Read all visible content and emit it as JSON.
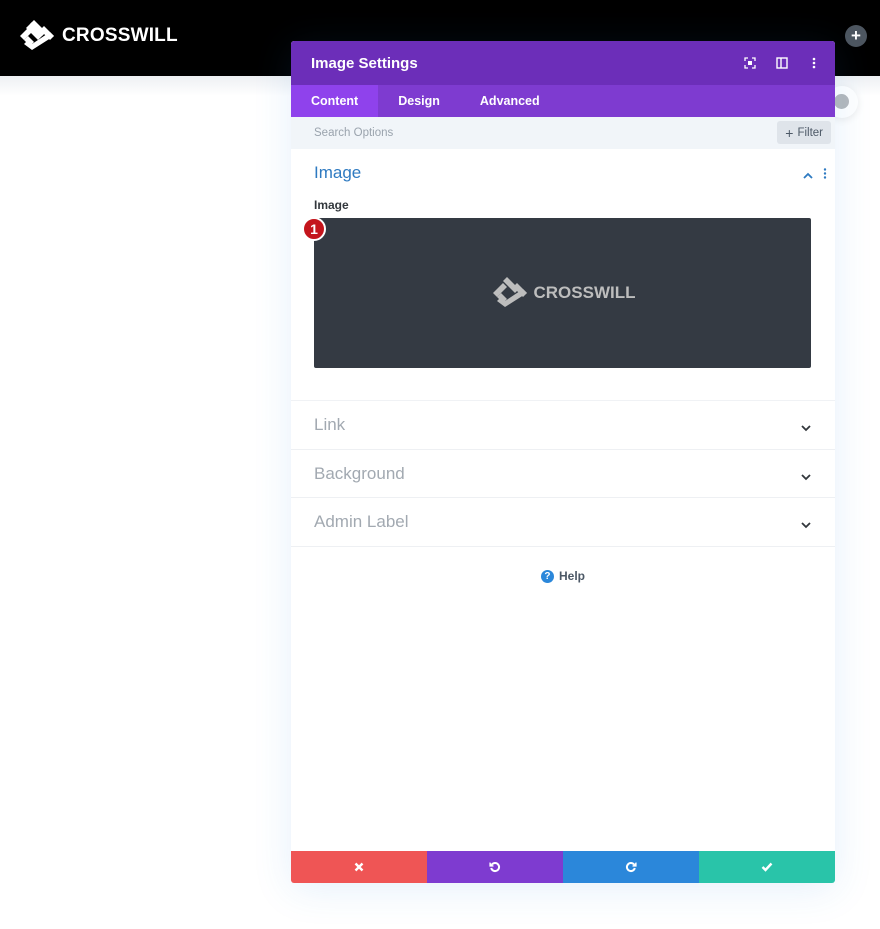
{
  "site": {
    "logo_text": "CROSSWILL"
  },
  "modal": {
    "title": "Image Settings",
    "header_icons": [
      "fullscreen-icon",
      "split-view-icon",
      "more-options-icon"
    ],
    "tabs": [
      {
        "label": "Content",
        "active": true
      },
      {
        "label": "Design",
        "active": false
      },
      {
        "label": "Advanced",
        "active": false
      }
    ],
    "search": {
      "placeholder": "Search Options",
      "value": ""
    },
    "filter_label": "Filter",
    "sections": {
      "image": {
        "title": "Image",
        "expanded": true,
        "field_label": "Image",
        "preview_logo_text": "CROSSWILL",
        "badge_number": "1"
      },
      "collapsed": [
        {
          "title": "Link"
        },
        {
          "title": "Background"
        },
        {
          "title": "Admin Label"
        }
      ]
    },
    "help_label": "Help",
    "footer": {
      "buttons": [
        {
          "name": "cancel",
          "icon": "close-icon",
          "color": "#ef5555"
        },
        {
          "name": "undo",
          "icon": "undo-icon",
          "color": "#7e3bd0"
        },
        {
          "name": "redo",
          "icon": "redo-icon",
          "color": "#2b87da"
        },
        {
          "name": "save",
          "icon": "check-icon",
          "color": "#29c4a9"
        }
      ]
    }
  },
  "colors": {
    "header_purple": "#6c2eb9",
    "tabs_purple": "#7e3bd0",
    "active_tab": "#8f42ec",
    "section_title_active": "#2e7ac1",
    "badge_red": "#c4151c"
  }
}
